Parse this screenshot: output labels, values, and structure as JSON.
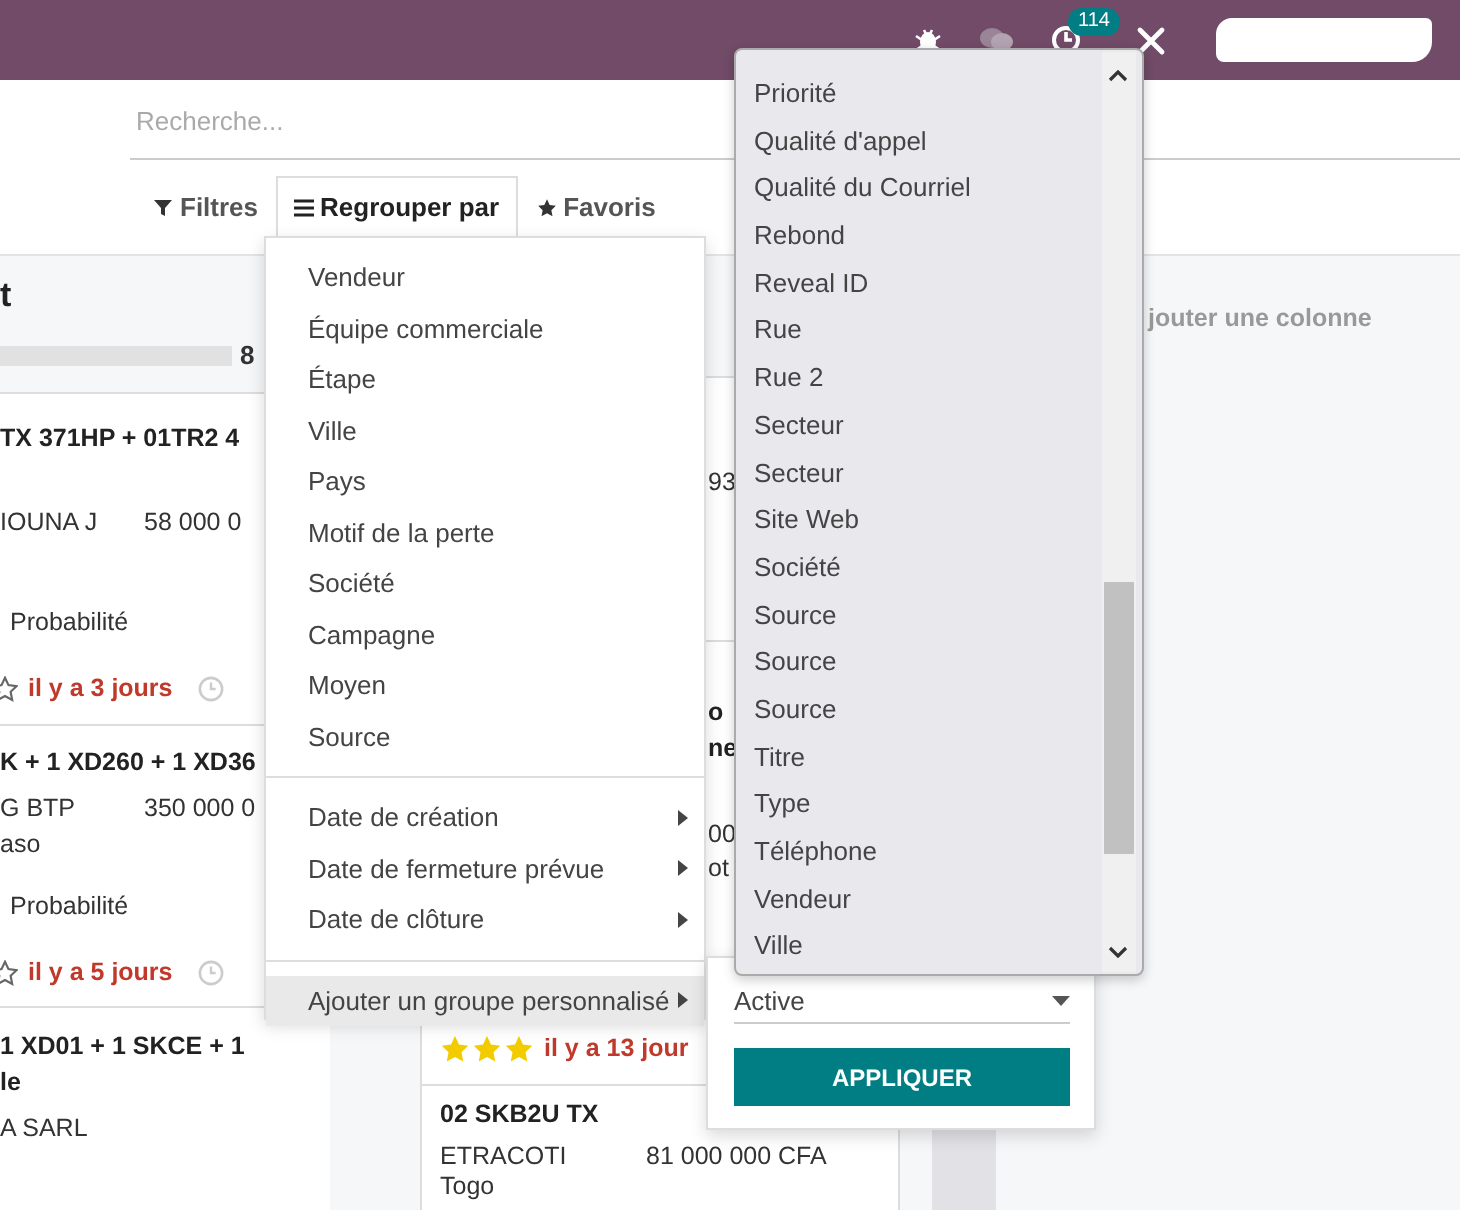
{
  "top_bar": {
    "notification_count": "114"
  },
  "search": {
    "placeholder": "Recherche..."
  },
  "search_tabs": [
    {
      "label": "Filtres",
      "selected": false
    },
    {
      "label": "Regrouper par",
      "selected": true
    },
    {
      "label": "Favoris",
      "selected": false
    }
  ],
  "kanban": {
    "columns": [
      {
        "kind": "cut",
        "title": "t",
        "total": "8",
        "progress": {
          "level": 1
        },
        "cards": [
          {
            "title_lines": [
              "TX 371HP + 01TR2 4"
            ],
            "customer": "IOUNA J",
            "amount": "58 000 0",
            "tag": "Probabilité",
            "deadline": "il y a 3 jours"
          },
          {
            "title_lines": [
              "K + 1 XD260 + 1 XD36"
            ],
            "customer": "G BTP",
            "amount": "350 000 0",
            "lines": [
              "aso"
            ],
            "tag": "Probabilité",
            "deadline": "il y a 5 jours"
          },
          {
            "title_lines": [
              "1 XD01 + 1 SKCE + 1",
              "le"
            ],
            "customer": "A SARL"
          }
        ]
      },
      {
        "kind": "covered",
        "cards": [
          {
            "kind": "fragment",
            "lines": [
              "93"
            ]
          },
          {
            "kind": "fragment",
            "title_lines": [
              "o",
              "ne"
            ],
            "lines": [
              "00",
              "ot"
            ]
          },
          {
            "kind": "footer",
            "stars": 3,
            "deadline": "il y a 13 jour"
          },
          {
            "kind": "full",
            "title_lines": [
              "02 SKB2U TX"
            ],
            "customer": "ETRACOTI",
            "amount": "81 000 000 CFA",
            "lines": [
              "Togo"
            ]
          }
        ]
      }
    ],
    "add_column": "jouter une colonne"
  },
  "group_by_menu": {
    "sections": [
      [
        {
          "label": "Vendeur",
          "submenu": false,
          "active": false
        },
        {
          "label": "Équipe commerciale",
          "submenu": false,
          "active": false
        },
        {
          "label": "Étape",
          "submenu": false,
          "active": false
        },
        {
          "label": "Ville",
          "submenu": false,
          "active": false
        },
        {
          "label": "Pays",
          "submenu": false,
          "active": false
        },
        {
          "label": "Motif de la perte",
          "submenu": false,
          "active": false
        },
        {
          "label": "Société",
          "submenu": false,
          "active": false
        },
        {
          "label": "Campagne",
          "submenu": false,
          "active": false
        },
        {
          "label": "Moyen",
          "submenu": false,
          "active": false
        },
        {
          "label": "Source",
          "submenu": false,
          "active": false
        }
      ],
      [
        {
          "label": "Date de création",
          "submenu": true,
          "active": false
        },
        {
          "label": "Date de fermeture prévue",
          "submenu": true,
          "active": false
        },
        {
          "label": "Date de clôture",
          "submenu": true,
          "active": false
        }
      ],
      [
        {
          "label": "Ajouter un groupe personnalisé",
          "submenu": true,
          "active": true
        }
      ]
    ]
  },
  "field_list": {
    "items": [
      "Priorité",
      "Qualité d'appel",
      "Qualité du Courriel",
      "Rebond",
      "Reveal ID",
      "Rue",
      "Rue 2",
      "Secteur",
      "Secteur",
      "Site Web",
      "Société",
      "Source",
      "Source",
      "Source",
      "Titre",
      "Type",
      "Téléphone",
      "Vendeur",
      "Ville"
    ]
  },
  "custom_group": {
    "value": "Active",
    "button": "APPLIQUER"
  }
}
